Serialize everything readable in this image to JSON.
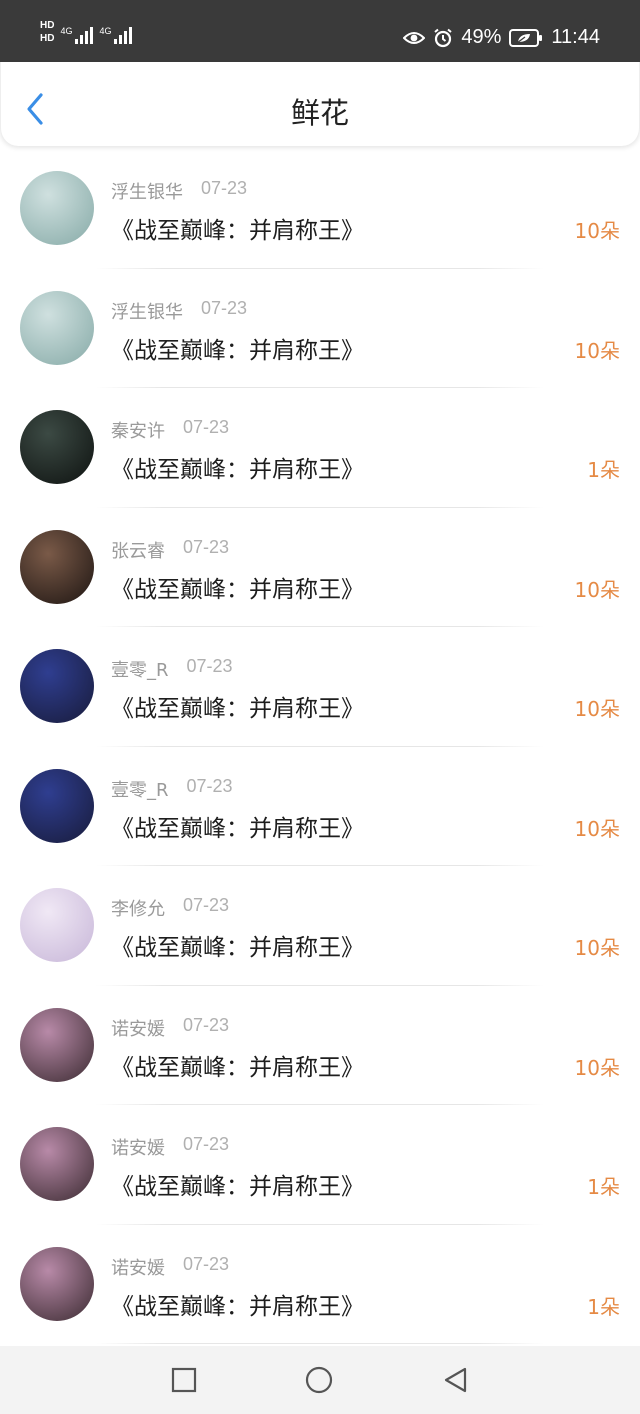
{
  "status_bar": {
    "hd1": "HD",
    "hd2": "HD",
    "net1": "4G",
    "net2": "4G",
    "battery": "49%",
    "time": "11:44"
  },
  "header": {
    "title": "鲜花"
  },
  "items": [
    {
      "name": "浮生银华",
      "date": "07-23",
      "book": "《战至巅峰：并肩称王》",
      "count": "10朵",
      "avatar_colors": [
        "#cfe0df",
        "#86aaa7"
      ]
    },
    {
      "name": "浮生银华",
      "date": "07-23",
      "book": "《战至巅峰：并肩称王》",
      "count": "10朵",
      "avatar_colors": [
        "#cfe0df",
        "#86aaa7"
      ]
    },
    {
      "name": "秦安许",
      "date": "07-23",
      "book": "《战至巅峰：并肩称王》",
      "count": "1朵",
      "avatar_colors": [
        "#3c4a44",
        "#0e1210"
      ]
    },
    {
      "name": "张云睿",
      "date": "07-23",
      "book": "《战至巅峰：并肩称王》",
      "count": "10朵",
      "avatar_colors": [
        "#7a5a48",
        "#1d1512"
      ]
    },
    {
      "name": "壹零_R",
      "date": "07-23",
      "book": "《战至巅峰：并肩称王》",
      "count": "10朵",
      "avatar_colors": [
        "#2f3e90",
        "#181b3a"
      ]
    },
    {
      "name": "壹零_R",
      "date": "07-23",
      "book": "《战至巅峰：并肩称王》",
      "count": "10朵",
      "avatar_colors": [
        "#2f3e90",
        "#181b3a"
      ]
    },
    {
      "name": "李修允",
      "date": "07-23",
      "book": "《战至巅峰：并肩称王》",
      "count": "10朵",
      "avatar_colors": [
        "#f0e8f5",
        "#c7b6d8"
      ]
    },
    {
      "name": "诺安媛",
      "date": "07-23",
      "book": "《战至巅峰：并肩称王》",
      "count": "10朵",
      "avatar_colors": [
        "#b88aa8",
        "#3a2a30"
      ]
    },
    {
      "name": "诺安媛",
      "date": "07-23",
      "book": "《战至巅峰：并肩称王》",
      "count": "1朵",
      "avatar_colors": [
        "#b88aa8",
        "#3a2a30"
      ]
    },
    {
      "name": "诺安媛",
      "date": "07-23",
      "book": "《战至巅峰：并肩称王》",
      "count": "1朵",
      "avatar_colors": [
        "#b88aa8",
        "#3a2a30"
      ]
    }
  ],
  "nav_bar": {
    "recent_icon": "square-icon",
    "home_icon": "circle-icon",
    "back_icon": "triangle-back-icon"
  },
  "colors": {
    "accent_blue": "#3a8ee6",
    "count_orange": "#e58a45",
    "status_bar": "#3a3a3a"
  }
}
